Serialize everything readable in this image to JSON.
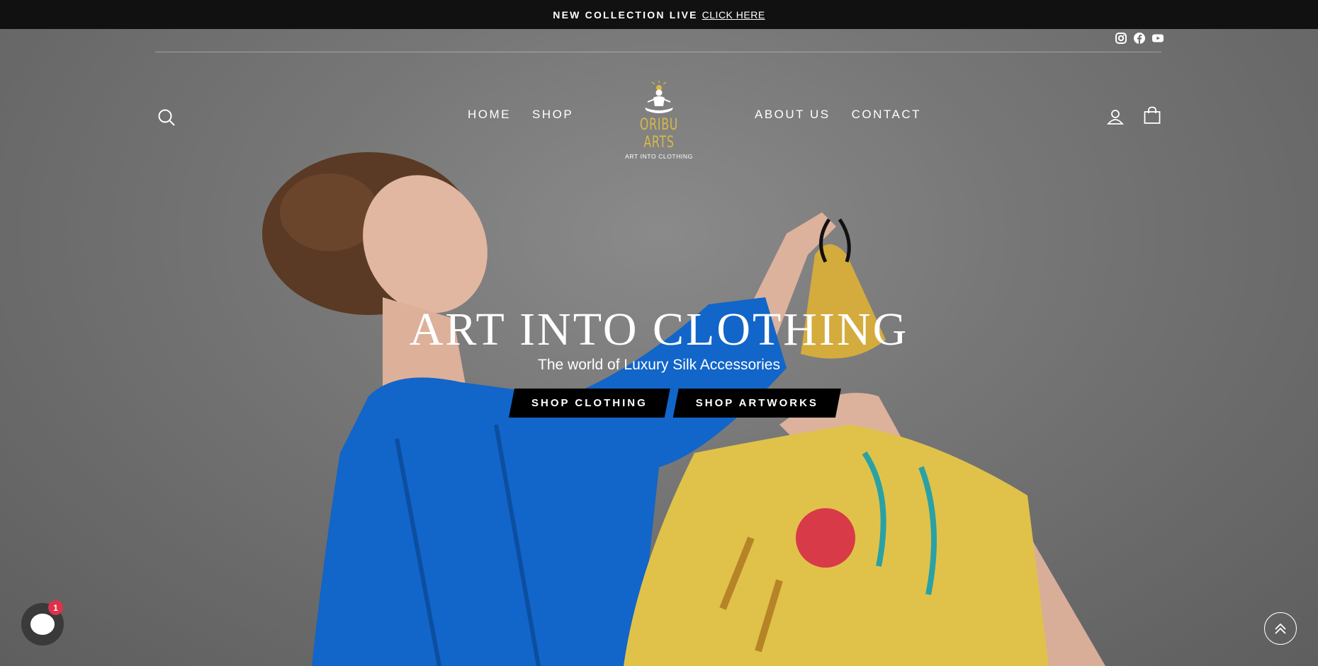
{
  "announcement": {
    "text": "NEW COLLECTION LIVE",
    "link": "CLICK HERE"
  },
  "social_icons": [
    "instagram-icon",
    "facebook-icon",
    "youtube-icon"
  ],
  "nav": {
    "left": [
      "HOME",
      "SHOP"
    ],
    "right": [
      "ABOUT US",
      "CONTACT"
    ]
  },
  "logo": {
    "brand": "ORIBU ARTS",
    "tagline": "ART INTO CLOTHING"
  },
  "header_icons": [
    "search-icon",
    "account-icon",
    "cart-icon"
  ],
  "hero": {
    "headline": "ART INTO CLOTHING",
    "subheadline": "The world of Luxury Silk Accessories",
    "buttons": [
      "SHOP CLOTHING",
      "SHOP ARTWORKS"
    ]
  },
  "chat": {
    "badge_count": "1"
  },
  "colors": {
    "announcement_bg": "#111111",
    "logo_gold": "#d8b84a",
    "badge_red": "#e0314a",
    "shirt_blue": "#1265c9",
    "skirt_yellow": "#e0c24a"
  }
}
